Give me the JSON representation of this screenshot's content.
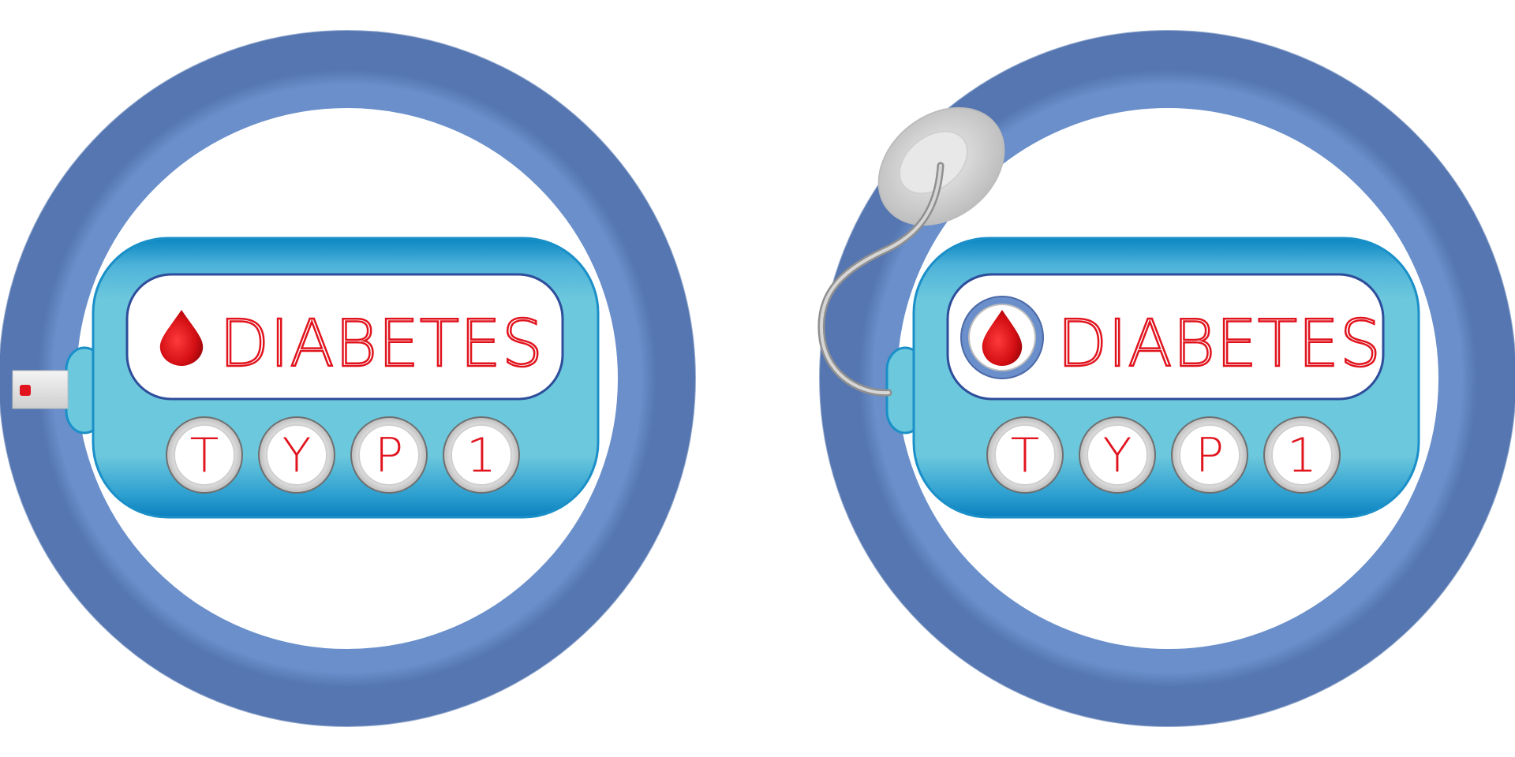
{
  "colors": {
    "ring": "#6a8fca",
    "device_blue": "#6cc8dd",
    "device_dark": "#0a86c2",
    "text_red": "#e1141e",
    "button_rim": "#d9d9d9"
  },
  "badges": [
    {
      "title": "DIABETES",
      "variant": "test-strip",
      "buttons": [
        "T",
        "Y",
        "P",
        "1"
      ]
    },
    {
      "title": "DIABETES",
      "variant": "pump-with-infusion-set",
      "buttons": [
        "T",
        "Y",
        "P",
        "1"
      ]
    }
  ],
  "icons": {
    "drop": "blood-drop-icon",
    "strip": "test-strip-icon",
    "infusion": "infusion-set-icon"
  }
}
